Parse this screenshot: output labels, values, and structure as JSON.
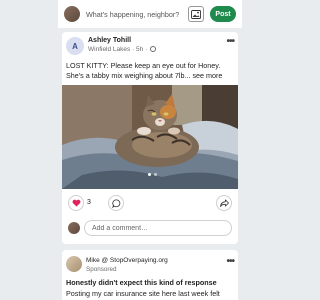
{
  "composer": {
    "prompt": "What's happening, neighbor?",
    "post_label": "Post"
  },
  "post": {
    "author_initial": "A",
    "author_name": "Ashley Tohill",
    "meta": "Winfield Lakes · 5h ·",
    "text_line1": "LOST KITTY: Please keep an eye out for Honey.",
    "text_line2": "She's a tabby mix weighing about 7lb...",
    "see_more": "see more",
    "reaction_count": "3",
    "comment_placeholder": "Add a comment…",
    "carousel": {
      "total": 2,
      "active": 0
    }
  },
  "ad": {
    "name": "Mike @ StopOverpaying.org",
    "sponsored": "Sponsored",
    "headline": "Honestly didn't expect this kind of response",
    "body": "Posting my car insurance site here last week felt"
  },
  "colors": {
    "brand_green": "#1f8a4c",
    "background": "#e9ecef",
    "card": "#ffffff",
    "heart": "#e0245e"
  },
  "icons": [
    "photo-icon",
    "more-icon",
    "globe-icon",
    "heart-icon",
    "comment-icon",
    "share-icon"
  ]
}
